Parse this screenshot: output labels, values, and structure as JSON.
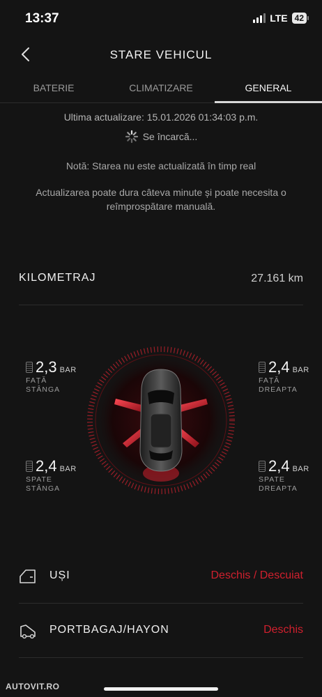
{
  "status_bar": {
    "time": "13:37",
    "network": "LTE",
    "battery": "42"
  },
  "header": {
    "title": "STARE VEHICUL"
  },
  "tabs": [
    {
      "label": "BATERIE",
      "active": false
    },
    {
      "label": "CLIMATIZARE",
      "active": false
    },
    {
      "label": "GENERAL",
      "active": true
    }
  ],
  "update": {
    "last_updated": "Ultima actualizare: 15.01.2026 01:34:03 p.m.",
    "loading": "Se încarcă..."
  },
  "notes": {
    "realtime": "Notă: Starea nu este actualizată în timp real",
    "manual_refresh": "Actualizarea poate dura câteva minute și poate necesita o reîmprospătare manuală."
  },
  "odometer": {
    "label": "KILOMETRAJ",
    "value": "27.161 km"
  },
  "tires": {
    "unit": "BAR",
    "front_left": {
      "value": "2,3",
      "pos1": "FAȚĂ",
      "pos2": "STÂNGA"
    },
    "front_right": {
      "value": "2,4",
      "pos1": "FAȚĂ",
      "pos2": "DREAPTA"
    },
    "rear_left": {
      "value": "2,4",
      "pos1": "SPATE",
      "pos2": "STÂNGA"
    },
    "rear_right": {
      "value": "2,4",
      "pos1": "SPATE",
      "pos2": "DREAPTA"
    }
  },
  "doors": {
    "label": "UȘI",
    "status": "Deschis / Descuiat"
  },
  "trunk": {
    "label": "PORTBAGAJ/HAYON",
    "status": "Deschis"
  },
  "watermark": "AUTOVIT.RO",
  "colors": {
    "accent_red": "#d0202e",
    "background": "#141414"
  }
}
